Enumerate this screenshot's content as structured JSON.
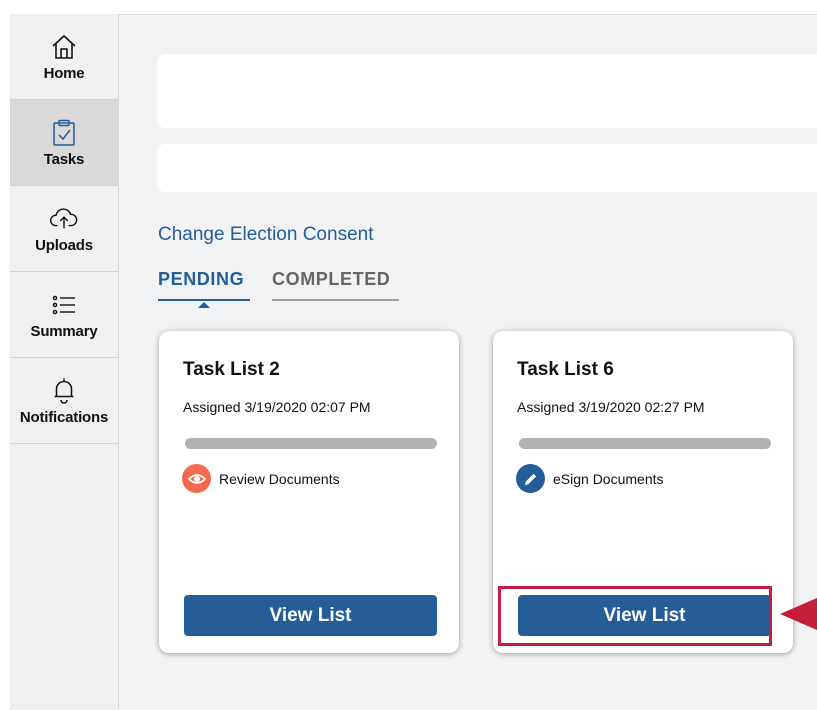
{
  "sidebar": {
    "items": [
      {
        "label": "Home",
        "icon": "home-icon"
      },
      {
        "label": "Tasks",
        "icon": "clipboard-check-icon",
        "active": true
      },
      {
        "label": "Uploads",
        "icon": "cloud-upload-icon"
      },
      {
        "label": "Summary",
        "icon": "list-icon"
      },
      {
        "label": "Notifications",
        "icon": "bell-icon"
      }
    ]
  },
  "main": {
    "section_title": "Change Election Consent",
    "tabs": [
      {
        "label": "PENDING",
        "active": true
      },
      {
        "label": "COMPLETED",
        "active": false
      }
    ],
    "cards": [
      {
        "title": "Task List 2",
        "assigned": "Assigned 3/19/2020 02:07 PM",
        "status_label": "Review Documents",
        "status_icon": "eye-icon",
        "status_color": "#f26b4f",
        "button_label": "View List"
      },
      {
        "title": "Task List 6",
        "assigned": "Assigned 3/19/2020 02:27 PM",
        "status_label": "eSign Documents",
        "status_icon": "pencil-icon",
        "status_color": "#245d97",
        "button_label": "View List"
      }
    ]
  },
  "colors": {
    "accent": "#245d97",
    "highlight": "#c41e3a",
    "review": "#f26b4f"
  }
}
